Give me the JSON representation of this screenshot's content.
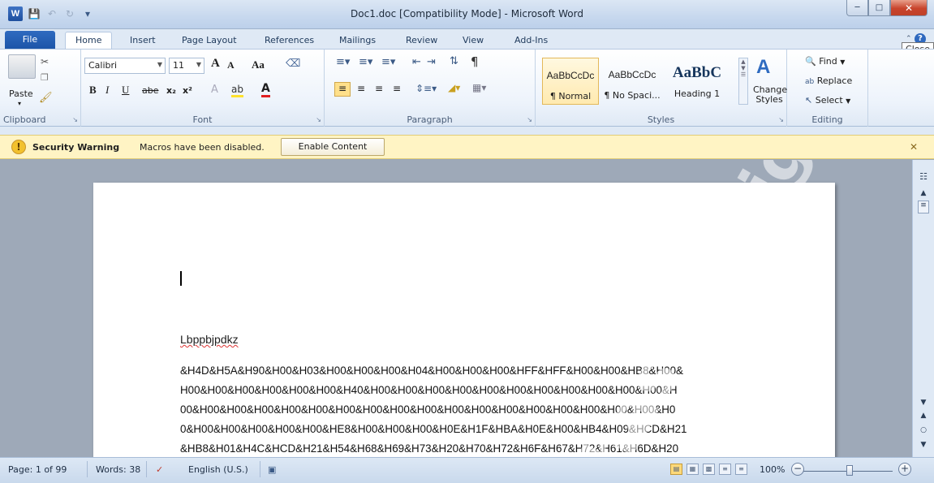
{
  "window": {
    "title": "Doc1.doc [Compatibility Mode]  -  Microsoft Word",
    "logo_letter": "W",
    "close_tooltip": "Close"
  },
  "tabs": [
    "File",
    "Home",
    "Insert",
    "Page Layout",
    "References",
    "Mailings",
    "Review",
    "View",
    "Add-Ins"
  ],
  "ribbon": {
    "clipboard": {
      "label": "Clipboard",
      "paste": "Paste"
    },
    "font": {
      "label": "Font",
      "font_name": "Calibri",
      "font_size": "11",
      "grow": "A",
      "shrink": "A",
      "case": "Aa",
      "bold": "B",
      "italic": "I",
      "underline": "U",
      "strike": "abe",
      "subscript": "x₂",
      "superscript": "x²"
    },
    "paragraph": {
      "label": "Paragraph"
    },
    "styles": {
      "label": "Styles",
      "items": [
        {
          "sample": "AaBbCcDc",
          "name": "¶ Normal"
        },
        {
          "sample": "AaBbCcDc",
          "name": "¶ No Spaci..."
        },
        {
          "sample": "AaBbC",
          "name": "Heading 1"
        }
      ],
      "change_styles": "Change Styles"
    },
    "editing": {
      "label": "Editing",
      "find": "Find",
      "replace": "Replace",
      "select": "Select"
    }
  },
  "security_bar": {
    "title": "Security Warning",
    "message": "Macros have been disabled.",
    "button": "Enable Content"
  },
  "document": {
    "heading": "Lbppbjpdkz",
    "lines": [
      "&H4D&H5A&H90&H00&H03&H00&H00&H00&H04&H00&H00&H00&HFF&HFF&H00&H00&HB8&H00&",
      "H00&H00&H00&H00&H00&H00&H40&H00&H00&H00&H00&H00&H00&H00&H00&H00&H00&H00&H",
      "00&H00&H00&H00&H00&H00&H00&H00&H00&H00&H00&H00&H00&H00&H00&H00&H00&H00&H0",
      "0&H00&H00&H00&H00&H00&HE8&H00&H00&H00&H0E&H1F&HBA&H0E&H00&HB4&H09&HCD&H21",
      "&HB8&H01&H4C&HCD&H21&H54&H68&H69&H73&H20&H70&H72&H6F&H67&H72&H61&H6D&H20"
    ],
    "watermark": "has full rights"
  },
  "status": {
    "page": "Page: 1 of 99",
    "words": "Words: 38",
    "language": "English (U.S.)",
    "zoom": "100%"
  }
}
